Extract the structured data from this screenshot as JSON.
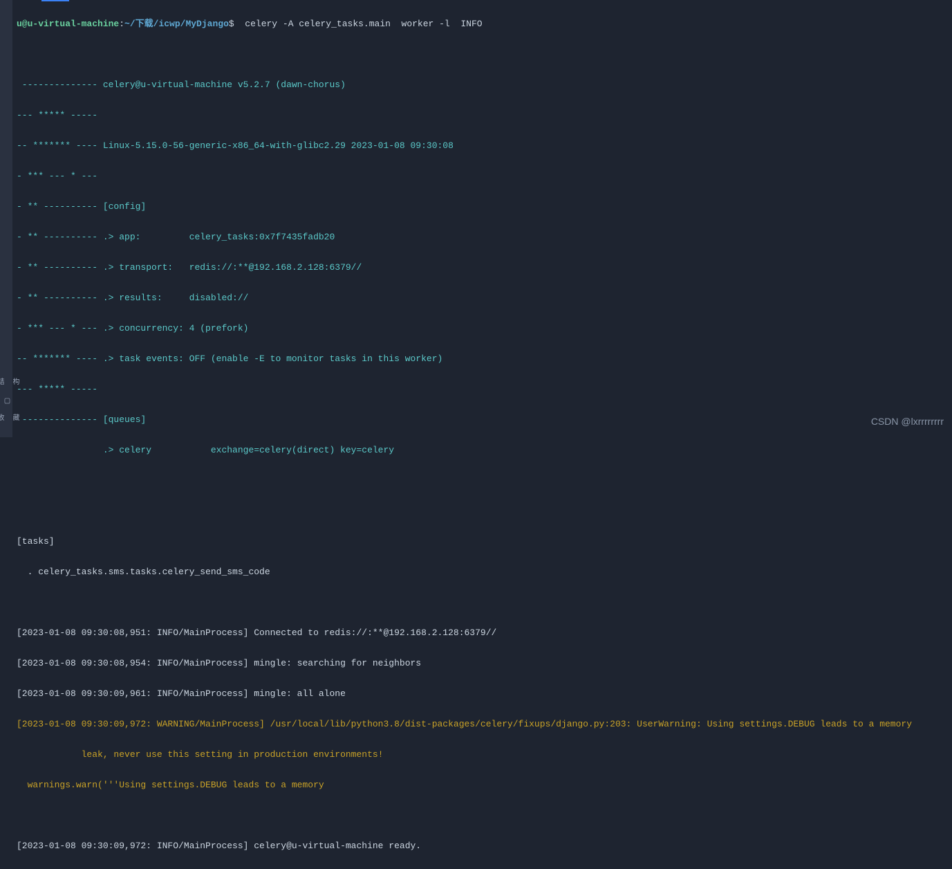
{
  "prompt": {
    "user": "u@u-virtual-machine",
    "path": "~/下载/icwp/MyDjango",
    "dollar": "$",
    "command": "  celery -A celery_tasks.main  worker -l  INFO"
  },
  "banner": {
    "l1": " -------------- celery@u-virtual-machine v5.2.7 (dawn-chorus)",
    "l2": "--- ***** -----",
    "l3": "-- ******* ---- Linux-5.15.0-56-generic-x86_64-with-glibc2.29 2023-01-08 09:30:08",
    "l4": "- *** --- * ---",
    "l5": "- ** ---------- [config]",
    "l6": "- ** ---------- .> app:         celery_tasks:0x7f7435fadb20",
    "l7": "- ** ---------- .> transport:   redis://:**@192.168.2.128:6379//",
    "l8": "- ** ---------- .> results:     disabled://",
    "l9": "- *** --- * --- .> concurrency: 4 (prefork)",
    "l10": "-- ******* ---- .> task events: OFF (enable -E to monitor tasks in this worker)",
    "l11": "--- ***** -----",
    "l12": " -------------- [queues]",
    "l13": "                .> celery           exchange=celery(direct) key=celery"
  },
  "tasks": {
    "header": "[tasks]",
    "item": "  . celery_tasks.sms.tasks.celery_send_sms_code"
  },
  "logs": {
    "l1": "[2023-01-08 09:30:08,951: INFO/MainProcess] Connected to redis://:**@192.168.2.128:6379//",
    "l2": "[2023-01-08 09:30:08,954: INFO/MainProcess] mingle: searching for neighbors",
    "l3": "[2023-01-08 09:30:09,961: INFO/MainProcess] mingle: all alone",
    "warn1": "[2023-01-08 09:30:09,972: WARNING/MainProcess] /usr/local/lib/python3.8/dist-packages/celery/fixups/django.py:203: UserWarning: Using settings.DEBUG leads to a memory",
    "warn2": "            leak, never use this setting in production environments!",
    "warn3": "  warnings.warn('''Using settings.DEBUG leads to a memory",
    "ready": "[2023-01-08 09:30:09,972: INFO/MainProcess] celery@u-virtual-machine ready."
  },
  "watermark": "CSDN @lxrrrrrrrr",
  "sidebar": {
    "icon1": "结构",
    "icon2": "▢",
    "icon3": "收藏"
  }
}
